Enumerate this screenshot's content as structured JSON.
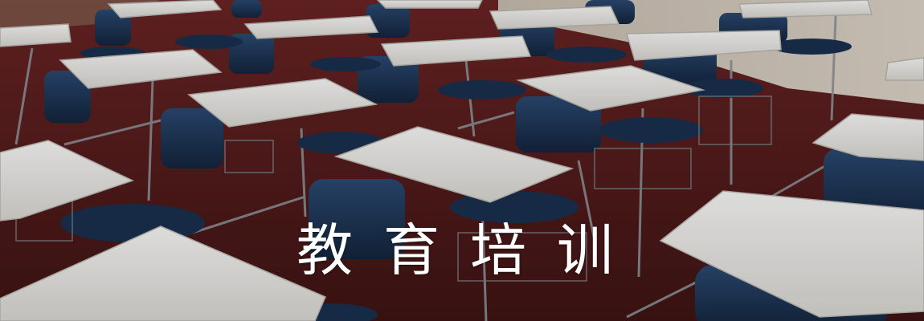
{
  "banner": {
    "caption": "教育培训",
    "colors": {
      "floor": "#5a1e1e",
      "wall": "#d9d2c3",
      "desk_top": "#f2f1ee",
      "chair": "#1f3657",
      "metal": "#9aa0a6",
      "caption": "#ffffff"
    }
  }
}
